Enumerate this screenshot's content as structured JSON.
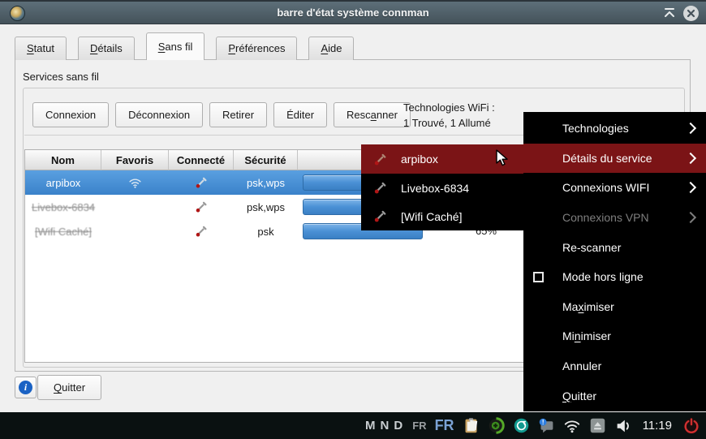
{
  "window": {
    "title": "barre d'état système connman"
  },
  "tabs": [
    {
      "label": "Statut",
      "m": 0
    },
    {
      "label": "Détails",
      "m": 0
    },
    {
      "label": "Sans fil",
      "m": 0,
      "active": true
    },
    {
      "label": "Préférences",
      "m": 0
    },
    {
      "label": "Aide",
      "m": 0
    }
  ],
  "wireless": {
    "group_label": "Services sans fil",
    "buttons": [
      {
        "label": "Connexion"
      },
      {
        "label": "Déconnexion"
      },
      {
        "label": "Retirer"
      },
      {
        "label": "Éditer"
      },
      {
        "label": "Rescanner",
        "m": 4
      }
    ],
    "status_line1": "Technologies WiFi :",
    "status_line2": "1 Trouvé, 1 Allumé"
  },
  "table": {
    "headers": [
      "Nom",
      "Favoris",
      "Connecté",
      "Sécurité"
    ],
    "rows": [
      {
        "name": "arpibox",
        "security": "psk,wps",
        "selected": true
      },
      {
        "name": "Livebox-6834",
        "security": "psk,wps",
        "selected": false
      },
      {
        "name": "[Wifi Caché]",
        "security": "psk",
        "selected": false,
        "signal_label": "65%"
      }
    ]
  },
  "footer": {
    "quit": {
      "label": "Quitter",
      "m": 0
    }
  },
  "submenu": {
    "items": [
      {
        "label": "arpibox",
        "highlighted": true
      },
      {
        "label": "Livebox-6834"
      },
      {
        "label": "[Wifi Caché]"
      }
    ]
  },
  "context_menu": {
    "items": [
      {
        "label": "Technologies"
      },
      {
        "label": "Détails du service"
      },
      {
        "label": "Connexions WIFI"
      },
      {
        "label": "Connexions VPN"
      },
      {
        "label": "Re-scanner"
      },
      {
        "label": "Mode hors ligne"
      },
      {
        "label": "Maximiser",
        "m": 2
      },
      {
        "label": "Minimiser",
        "m": 2
      },
      {
        "label": "Annuler"
      },
      {
        "label": "Quitter",
        "m": 0
      }
    ]
  },
  "taskbar": {
    "indicator_m": "M",
    "indicator_n": "N",
    "indicator_d": "D",
    "layout_small": "FR",
    "layout_large": "FR",
    "time": "11:19"
  },
  "colors": {
    "selection_blue": "#4a90d5",
    "menu_highlight_red": "#7b1416",
    "taskbar_bg": "#0a1111",
    "fr_blue": "#7aa2d4",
    "power_red": "#d03030",
    "info_blue": "#1a62c4"
  }
}
